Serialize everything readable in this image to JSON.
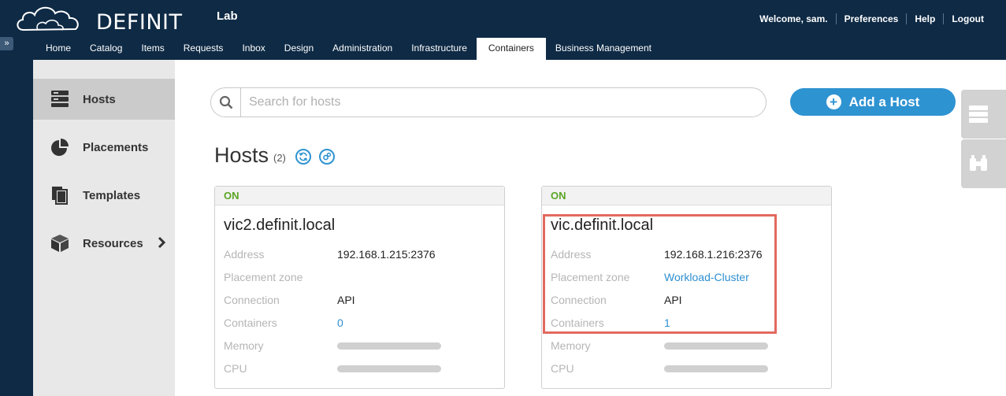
{
  "header": {
    "brand": "DEFINIT",
    "tenant": "Lab",
    "user_links": [
      "Welcome, sam.",
      "Preferences",
      "Help",
      "Logout"
    ]
  },
  "nav": {
    "tabs": [
      {
        "label": "Home"
      },
      {
        "label": "Catalog"
      },
      {
        "label": "Items"
      },
      {
        "label": "Requests"
      },
      {
        "label": "Inbox"
      },
      {
        "label": "Design"
      },
      {
        "label": "Administration"
      },
      {
        "label": "Infrastructure"
      },
      {
        "label": "Containers",
        "active": true
      },
      {
        "label": "Business Management"
      }
    ]
  },
  "sidebar": {
    "items": [
      {
        "label": "Hosts",
        "icon": "server-stack-icon",
        "active": true
      },
      {
        "label": "Placements",
        "icon": "pie-chart-icon"
      },
      {
        "label": "Templates",
        "icon": "copy-documents-icon"
      },
      {
        "label": "Resources",
        "icon": "cube-icon"
      }
    ]
  },
  "main": {
    "search_placeholder": "Search for hosts",
    "add_button": "Add a Host",
    "title": "Hosts",
    "count": "(2)"
  },
  "hosts": [
    {
      "status": "ON",
      "name": "vic2.definit.local",
      "labels": {
        "address": "Address",
        "placement_zone": "Placement zone",
        "connection": "Connection",
        "containers": "Containers",
        "memory": "Memory",
        "cpu": "CPU"
      },
      "address": "192.168.1.215:2376",
      "placement_zone": "",
      "connection": "API",
      "containers": "0"
    },
    {
      "status": "ON",
      "name": "vic.definit.local",
      "labels": {
        "address": "Address",
        "placement_zone": "Placement zone",
        "connection": "Connection",
        "containers": "Containers",
        "memory": "Memory",
        "cpu": "CPU"
      },
      "address": "192.168.1.216:2376",
      "placement_zone": "Workload-Cluster",
      "connection": "API",
      "containers": "1"
    }
  ],
  "colors": {
    "header_bg": "#0e2a45",
    "accent": "#2e93d1",
    "status_on": "#5aa524",
    "highlight": "#e2695f"
  }
}
